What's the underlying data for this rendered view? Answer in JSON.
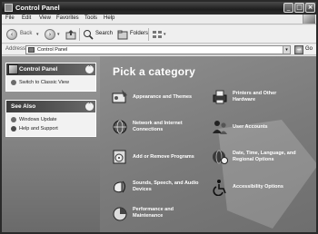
{
  "window": {
    "title": "Control Panel"
  },
  "menu": {
    "items": [
      "File",
      "Edit",
      "View",
      "Favorites",
      "Tools",
      "Help"
    ]
  },
  "toolbar": {
    "back_label": "Back",
    "search_label": "Search",
    "folders_label": "Folders"
  },
  "address": {
    "label": "Address",
    "value": "Control Panel",
    "go_label": "Go"
  },
  "sidebar": {
    "control_panel": {
      "title": "Control Panel",
      "links": [
        "Switch to Classic View"
      ]
    },
    "see_also": {
      "title": "See Also",
      "links": [
        "Windows Update",
        "Help and Support"
      ]
    }
  },
  "main": {
    "heading": "Pick a category",
    "categories": [
      {
        "label": "Appearance and Themes",
        "icon": "appearance-themes-icon"
      },
      {
        "label": "Printers and Other\nHardware",
        "icon": "printer-icon"
      },
      {
        "label": "Network and Internet\nConnections",
        "icon": "network-globe-icon"
      },
      {
        "label": "User Accounts",
        "icon": "user-accounts-icon"
      },
      {
        "label": "Add or Remove Programs",
        "icon": "add-remove-programs-icon"
      },
      {
        "label": "Date, Time, Language, and\nRegional Options",
        "icon": "date-time-globe-icon"
      },
      {
        "label": "Sounds, Speech, and Audio\nDevices",
        "icon": "sounds-speaker-icon"
      },
      {
        "label": "Accessibility Options",
        "icon": "accessibility-icon"
      },
      {
        "label": "Performance and\nMaintenance",
        "icon": "performance-chart-icon"
      }
    ]
  }
}
